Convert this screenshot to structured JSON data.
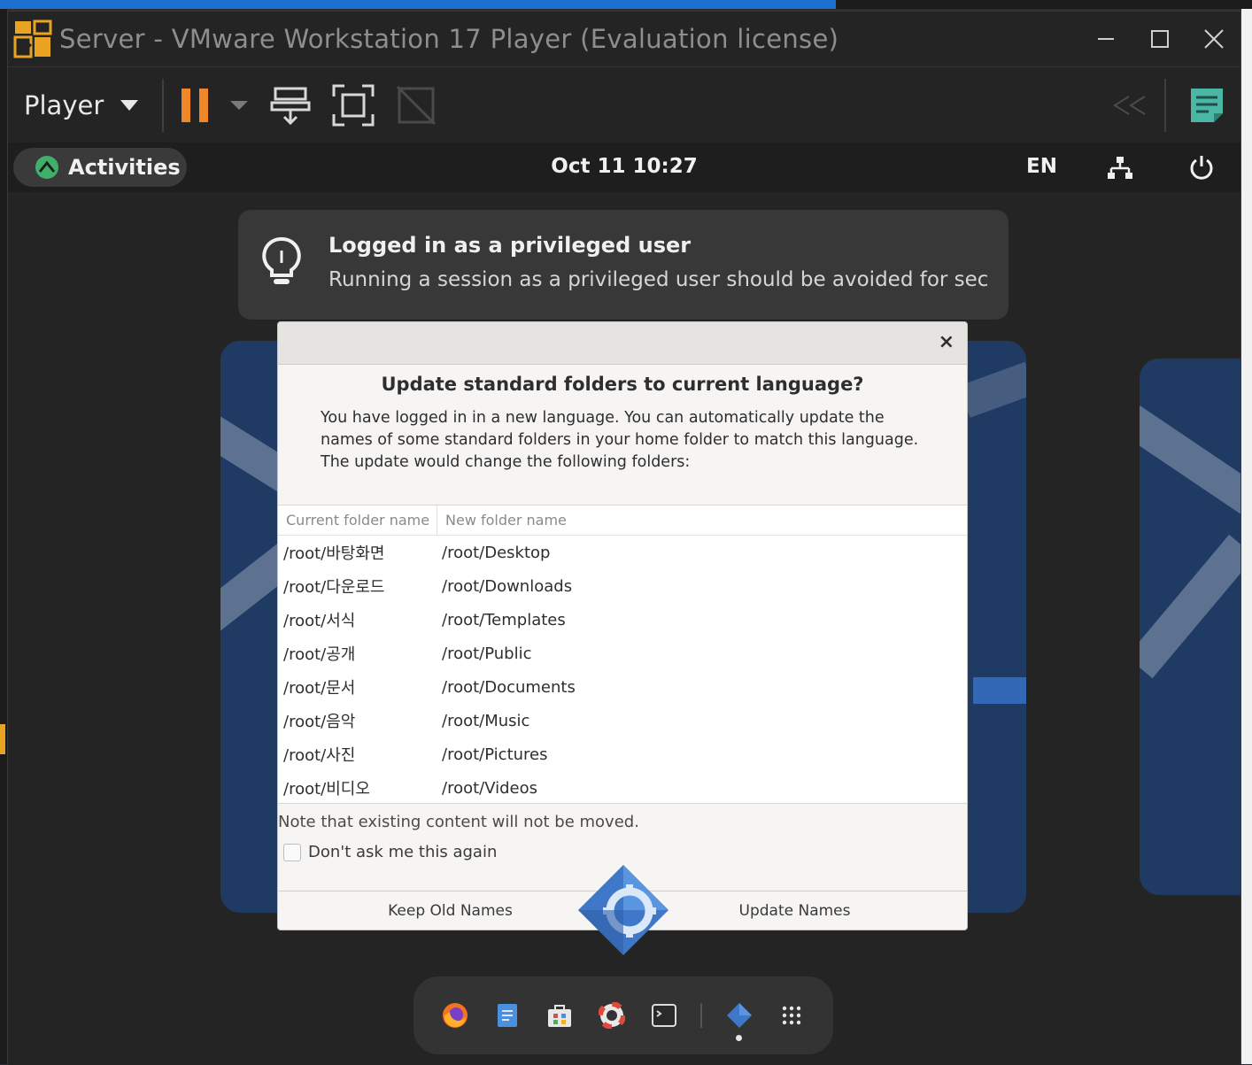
{
  "window": {
    "title": "Server - VMware Workstation 17 Player (Evaluation license)"
  },
  "toolbar": {
    "player_label": "Player"
  },
  "gnome_topbar": {
    "activities_label": "Activities",
    "clock": "Oct 11  10:27",
    "language": "EN"
  },
  "notification": {
    "title": "Logged in as a privileged user",
    "body": "Running a session as a privileged user should be avoided for sec…"
  },
  "dialog": {
    "close_glyph": "×",
    "title": "Update standard folders to current language?",
    "description": "You have logged in in a new language. You can automatically update the names of some standard folders in your home folder to match this language. The update would change the following folders:",
    "columns": [
      "Current folder name",
      "New folder name"
    ],
    "rows": [
      {
        "current": "/root/바탕화면",
        "new": "/root/Desktop"
      },
      {
        "current": "/root/다운로드",
        "new": "/root/Downloads"
      },
      {
        "current": "/root/서식",
        "new": "/root/Templates"
      },
      {
        "current": "/root/공개",
        "new": "/root/Public"
      },
      {
        "current": "/root/문서",
        "new": "/root/Documents"
      },
      {
        "current": "/root/음악",
        "new": "/root/Music"
      },
      {
        "current": "/root/사진",
        "new": "/root/Pictures"
      },
      {
        "current": "/root/비디오",
        "new": "/root/Videos"
      }
    ],
    "note": "Note that existing content will not be moved.",
    "checkbox_label": "Don't ask me this again",
    "checkbox_checked": false,
    "keep_button": "Keep Old Names",
    "update_button": "Update Names"
  },
  "dock": {
    "items": [
      "firefox-icon",
      "text-editor-icon",
      "software-icon",
      "help-icon",
      "terminal-icon",
      "settings-app-icon",
      "app-grid-icon"
    ]
  },
  "colors": {
    "pause_orange": "#f0882a",
    "gnome_topbar": "#1e1e1e",
    "dialog_bg": "#f6f5f4",
    "wallpaper_blue": "#1f3a63"
  }
}
